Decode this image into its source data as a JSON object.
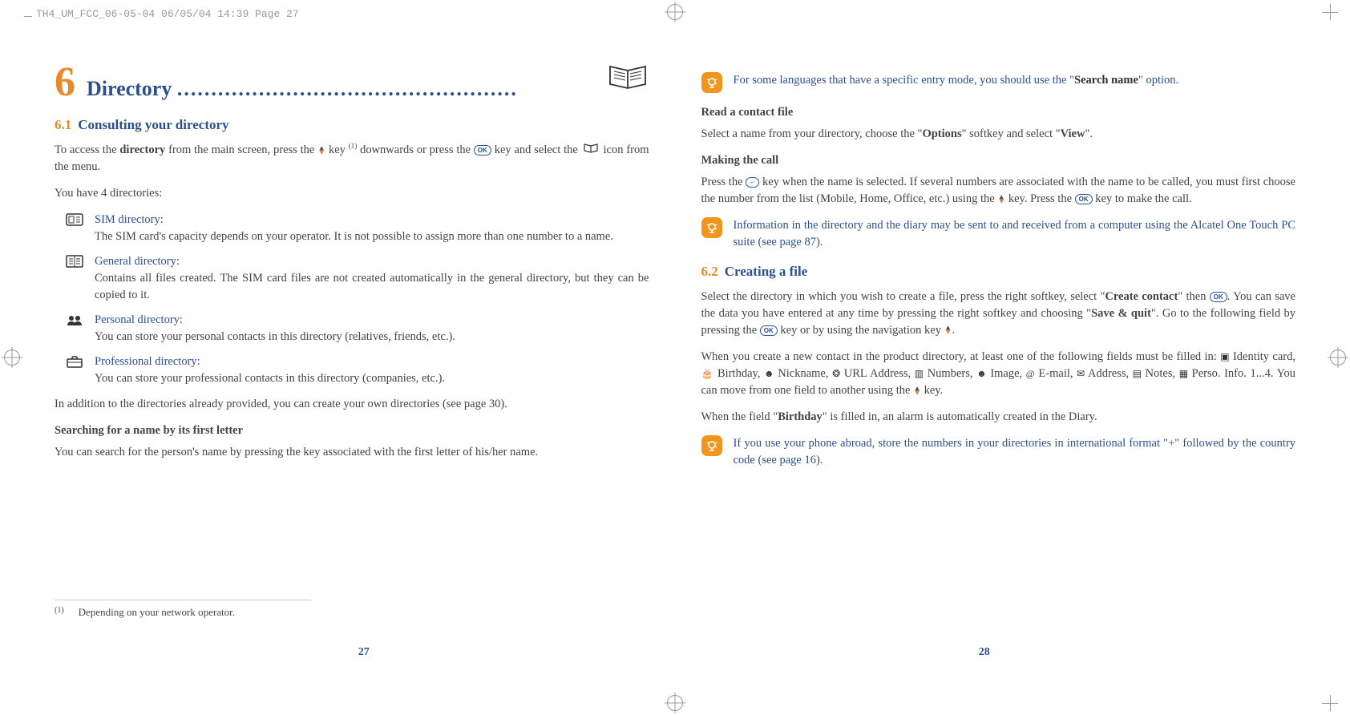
{
  "meta": {
    "header_line": "TH4_UM_FCC_06-05-04  06/05/04  14:39  Page 27"
  },
  "left": {
    "chapter_number": "6",
    "chapter_title": "Directory",
    "section_num": "6.1",
    "section_title": "Consulting your directory",
    "intro_1a": "To access the ",
    "intro_1b": "directory",
    "intro_1c": " from the main screen, press the ",
    "intro_1d": " key ",
    "intro_fn": "(1)",
    "intro_1e": " downwards or press the ",
    "intro_1f": " key and select the ",
    "intro_1g": " icon from the menu.",
    "you_have": "You have 4 directories:",
    "dirs": [
      {
        "name": "SIM directory:",
        "desc": "The SIM card's capacity depends on your operator. It is not possible to assign more than one number to a name."
      },
      {
        "name": "General directory:",
        "desc": "Contains all files created. The SIM card files are not created automatically in the general directory, but they can be copied to it."
      },
      {
        "name": "Personal directory:",
        "desc": "You can store your personal contacts in this directory (relatives, friends, etc.)."
      },
      {
        "name": "Professional directory:",
        "desc": "You can store your professional contacts in this directory (companies, etc.)."
      }
    ],
    "addition": "In addition to the directories already provided, you can create your own directories (see page 30).",
    "search_heading": "Searching for a name by its first letter",
    "search_text": "You can search for the person's name by pressing the key associated with the first letter of his/her name.",
    "footnote_mark": "(1)",
    "footnote_text": "Depending on your network operator.",
    "page_num": "27"
  },
  "right": {
    "note1_a": "For some languages that have a specific entry mode, you should use the \"",
    "note1_b": "Search name",
    "note1_c": "\" option.",
    "read_heading": "Read a contact file",
    "read_text_a": "Select a name from your directory, choose the \"",
    "read_text_b": "Options",
    "read_text_c": "\" softkey and select \"",
    "read_text_d": "View",
    "read_text_e": "\".",
    "call_heading": "Making the call",
    "call_text_a": "Press the ",
    "call_text_b": " key when the name is selected. If several numbers are associated with the name to be called, you must first choose the number from the list (Mobile, Home, Office, etc.) using the ",
    "call_text_c": " key. Press the ",
    "call_text_d": " key to make the call.",
    "note2": "Information in the directory and the diary may be sent to and received from a computer using the Alcatel One Touch PC suite (see page 87).",
    "section2_num": "6.2",
    "section2_title": "Creating a file",
    "create_a": "Select the directory in which you wish to create a file, press the right softkey, select \"",
    "create_b": "Create contact",
    "create_c": "\" then ",
    "create_d": ". You can save the data you have entered at any time by pressing the right softkey and choosing \"",
    "create_e": "Save & quit",
    "create_f": "\". Go to the following field by pressing the ",
    "create_g": " key or by using the navigation key ",
    "create_h": ".",
    "fields_a": "When you create a new contact in the product directory, at least one of the following fields must be filled in: ",
    "fields_list": [
      "Identity card,",
      "Birthday,",
      "Nickname,",
      "URL Address,",
      "Numbers,",
      "Image,",
      "E-mail,",
      "Address,",
      "Notes,",
      "Perso. Info. 1...4."
    ],
    "fields_b": " You can move from one field to another using the ",
    "fields_c": " key.",
    "birthday_a": "When the field \"",
    "birthday_b": "Birthday",
    "birthday_c": "\" is filled in, an alarm is automatically created in the Diary.",
    "note3": "If you use your phone abroad, store the numbers in your directories in international format \"+\" followed by the country code (see page 16).",
    "page_num": "28"
  }
}
